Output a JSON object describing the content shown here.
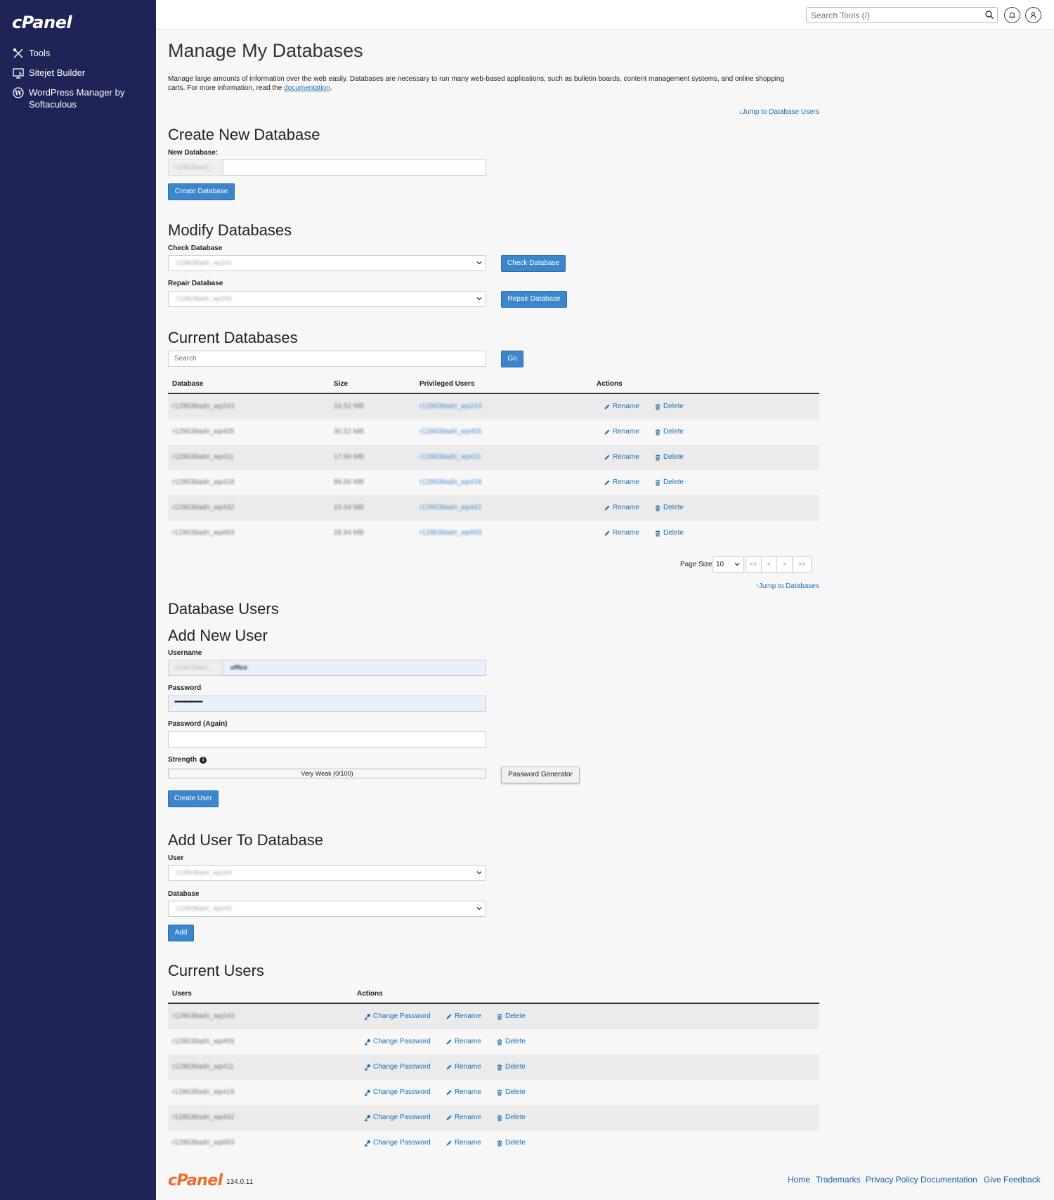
{
  "brand": {
    "logo_text": "cPanel"
  },
  "sidebar": {
    "items": [
      {
        "label": "Tools",
        "icon": "tools-icon"
      },
      {
        "label": "Sitejet Builder",
        "icon": "sitejet-icon"
      },
      {
        "label": "WordPress Manager by",
        "label2": "Softaculous",
        "icon": "wordpress-icon"
      }
    ]
  },
  "topbar": {
    "search_placeholder": "Search Tools (/)"
  },
  "page": {
    "title": "Manage My Databases",
    "description_1": "Manage large amounts of information over the web easily. Databases are necessary to run many web-based applications, such as bulletin boards, content management systems, and online shopping",
    "description_2": "carts. For more information, read the ",
    "description_link": "documentation",
    "description_end": ".",
    "jump_users": "Jump to Database Users",
    "jump_databases": "Jump to Databases"
  },
  "create_db": {
    "heading": "Create New Database",
    "label": "New Database:",
    "prefix": "r128638adri_",
    "button": "Create Database"
  },
  "modify_db": {
    "heading": "Modify Databases",
    "check_label": "Check Database",
    "check_value": "r128638adri_wp243",
    "check_button": "Check Database",
    "repair_label": "Repair Database",
    "repair_value": "r128638adri_wp243",
    "repair_button": "Repair Database"
  },
  "current_db": {
    "heading": "Current Databases",
    "search_placeholder": "Search",
    "go_button": "Go",
    "columns": [
      "Database",
      "Size",
      "Privileged Users",
      "Actions"
    ],
    "rename_label": "Rename",
    "delete_label": "Delete",
    "rows": [
      {
        "name": "r128638adri_wp243",
        "size": "16.52 MB",
        "user": "r128638adri_wp243"
      },
      {
        "name": "r128638adri_wp405",
        "size": "30.52 MB",
        "user": "r128638adri_wp405"
      },
      {
        "name": "r128638adri_wp411",
        "size": "17.66 MB",
        "user": "r128638adri_wp411"
      },
      {
        "name": "r128638adri_wp418",
        "size": "89.66 MB",
        "user": "r128638adri_wp418"
      },
      {
        "name": "r128638adri_wp442",
        "size": "15.04 MB",
        "user": "r128638adri_wp442"
      },
      {
        "name": "r128638adri_wp693",
        "size": "28.84 MB",
        "user": "r128638adri_wp693"
      }
    ],
    "page_size_label": "Page Size",
    "page_size_value": "10",
    "pager": [
      "<<",
      "<",
      ">",
      ">>"
    ]
  },
  "db_users": {
    "heading": "Database Users",
    "add_heading": "Add New User",
    "username_label": "Username",
    "username_prefix": "r128638adri_",
    "username_value": "office",
    "password_label": "Password",
    "password_value": "••••••••••••••••",
    "password_again_label": "Password (Again)",
    "strength_label": "Strength",
    "strength_text": "Very Weak (0/100)",
    "strength_value": 0,
    "generator_button": "Password Generator",
    "create_button": "Create User"
  },
  "add_user_to_db": {
    "heading": "Add User To Database",
    "user_label": "User",
    "user_value": "r128638adri_wp243",
    "db_label": "Database",
    "db_value": "r128638adri_wp243",
    "add_button": "Add"
  },
  "current_users": {
    "heading": "Current Users",
    "columns": [
      "Users",
      "Actions"
    ],
    "change_password_label": "Change Password",
    "rename_label": "Rename",
    "delete_label": "Delete",
    "rows": [
      "r128638adri_wp243",
      "r128638adri_wp405",
      "r128638adri_wp411",
      "r128638adri_wp418",
      "r128638adri_wp442",
      "r128638adri_wp693"
    ]
  },
  "footer": {
    "logo_text": "cPanel",
    "version": "134.0.11",
    "links": [
      "Home",
      "Trademarks",
      "Privacy Policy",
      "Documentation",
      "Give Feedback"
    ]
  },
  "colors": {
    "sidebar": "#1f2357",
    "primary_button": "#3b86cc",
    "link": "#1a6fb3",
    "footer_logo": "#f26a28"
  }
}
